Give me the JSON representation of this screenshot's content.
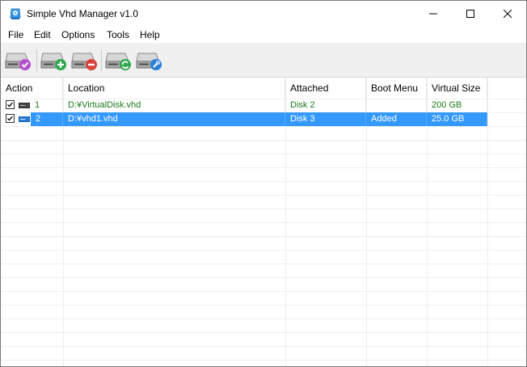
{
  "window": {
    "title": "Simple Vhd Manager v1.0"
  },
  "menu": {
    "items": [
      "File",
      "Edit",
      "Options",
      "Tools",
      "Help"
    ]
  },
  "toolbar": {
    "buttons": [
      {
        "name": "attach-disk",
        "icon": "disk-check-icon",
        "accent": "#b44fd0"
      },
      {
        "name": "add-disk",
        "icon": "disk-plus-icon",
        "accent": "#2fa84f"
      },
      {
        "name": "remove-disk",
        "icon": "disk-minus-icon",
        "accent": "#d9423a"
      },
      {
        "name": "refresh-disk",
        "icon": "disk-refresh-icon",
        "accent": "#2fa84f"
      },
      {
        "name": "settings-disk",
        "icon": "disk-wrench-icon",
        "accent": "#2b7fd8"
      }
    ]
  },
  "table": {
    "columns": [
      "Action",
      "Location",
      "Attached",
      "Boot Menu",
      "Virtual Size"
    ],
    "rows": [
      {
        "checked": true,
        "num": "1",
        "location": "D:¥VirtualDisk.vhd",
        "attached": "Disk 2",
        "boot": "",
        "size": "200 GB",
        "selected": false
      },
      {
        "checked": true,
        "num": "2",
        "location": "D:¥vhd1.vhd",
        "attached": "Disk 3",
        "boot": "Added",
        "size": "25.0 GB",
        "selected": true
      }
    ]
  },
  "colors": {
    "selection": "#3399ff",
    "row_text_green": "#1a7a1a",
    "toolbar_bg": "#f0f0f0"
  }
}
